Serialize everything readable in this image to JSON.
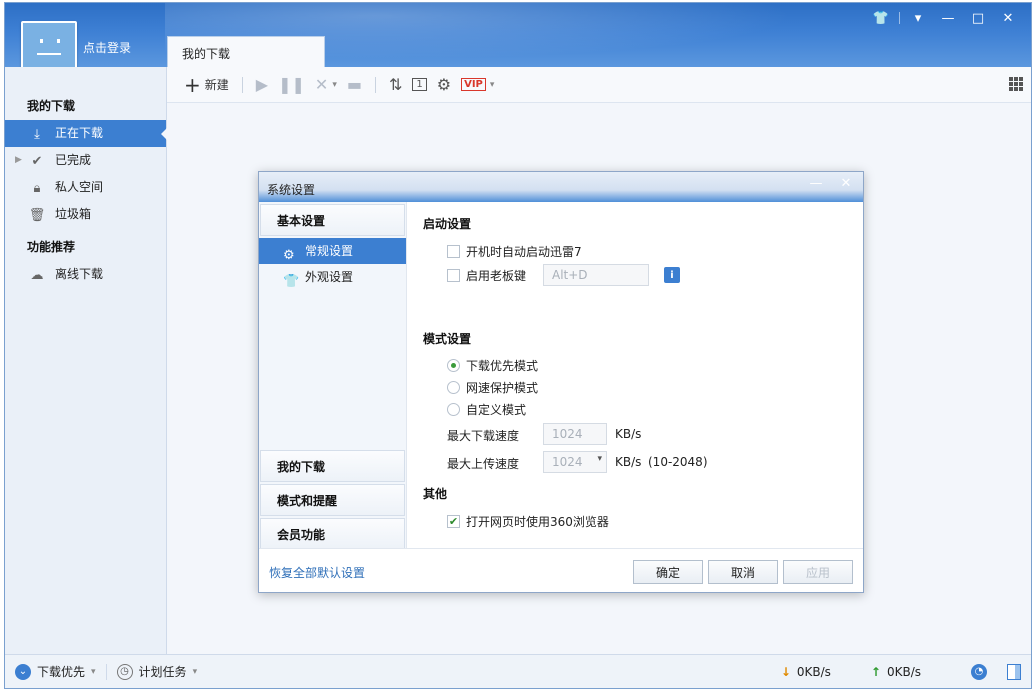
{
  "window": {
    "controls": [
      "skin",
      "menu",
      "minimize",
      "maximize",
      "close"
    ]
  },
  "user": {
    "login_label": "点击登录"
  },
  "tabs": [
    {
      "label": "我的下载"
    }
  ],
  "toolbar": {
    "new_label": "新建",
    "icons": [
      "plus-icon",
      "play-icon",
      "pause-icon",
      "delete-icon",
      "folder-icon",
      "sort-icon",
      "one-icon",
      "gear-icon",
      "vip-icon",
      "grid-icon"
    ]
  },
  "sidebar": {
    "groups": [
      {
        "title": "我的下载",
        "items": [
          {
            "label": "正在下载",
            "icon": "download-icon",
            "active": true
          },
          {
            "label": "已完成",
            "icon": "check-icon",
            "active": false
          },
          {
            "label": "私人空间",
            "icon": "lock-icon",
            "active": false
          },
          {
            "label": "垃圾箱",
            "icon": "trash-icon",
            "active": false
          }
        ]
      },
      {
        "title": "功能推荐",
        "items": [
          {
            "label": "离线下载",
            "icon": "cloud-icon",
            "active": false
          }
        ]
      }
    ]
  },
  "statusbar": {
    "priority_label": "下载优先",
    "schedule_label": "计划任务",
    "down_speed": "0KB/s",
    "up_speed": "0KB/s"
  },
  "dialog": {
    "title": "系统设置",
    "categories": {
      "basic": "基本设置",
      "basic_items": [
        {
          "label": "常规设置",
          "icon": "gear-icon",
          "selected": true
        },
        {
          "label": "外观设置",
          "icon": "shirt-icon",
          "selected": false
        }
      ],
      "my_download": "我的下载",
      "mode_reminder": "模式和提醒",
      "member": "会员功能"
    },
    "startup": {
      "title": "启动设置",
      "autostart_label": "开机时自动启动迅雷7",
      "autostart_checked": false,
      "bosskey_label": "启用老板键",
      "bosskey_checked": false,
      "bosskey_value": "Alt+D"
    },
    "mode": {
      "title": "模式设置",
      "options": [
        {
          "label": "下载优先模式",
          "selected": true
        },
        {
          "label": "网速保护模式",
          "selected": false
        },
        {
          "label": "自定义模式",
          "selected": false
        }
      ],
      "max_download_label": "最大下载速度",
      "max_download_value": "1024",
      "max_download_unit": "KB/s",
      "max_upload_label": "最大上传速度",
      "max_upload_value": "1024",
      "max_upload_unit": "KB/s",
      "max_upload_range": "(10-2048)"
    },
    "other": {
      "title": "其他",
      "browser360_label": "打开网页时使用360浏览器",
      "browser360_checked": true
    },
    "footer": {
      "restore_label": "恢复全部默认设置",
      "ok_label": "确定",
      "cancel_label": "取消",
      "apply_label": "应用"
    }
  }
}
